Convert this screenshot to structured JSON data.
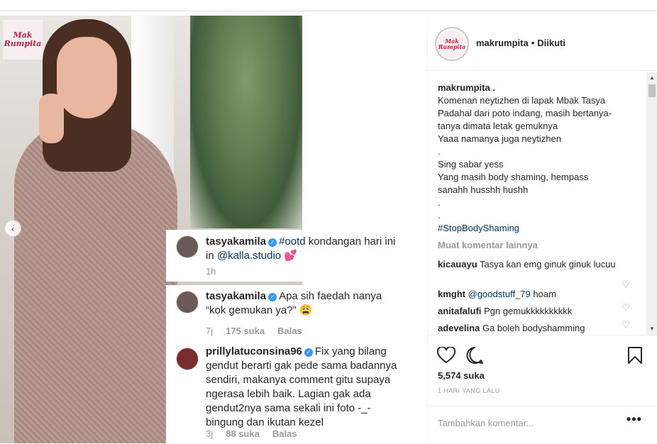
{
  "post_media": {
    "logo_text": "Mak Rumpita",
    "comments": [
      {
        "username": "tasyakamila",
        "hashtag": "#ootd",
        "text_1": "kondangan hari ini",
        "text_2_prefix": "in",
        "mention": "@kalla.studio",
        "emoji": "💕",
        "time": "1h"
      },
      {
        "username": "tasyakamila",
        "text_1": "Apa sih faedah nanya",
        "text_2": "“kok gemukan ya?”",
        "emoji": "😩",
        "time": "7j",
        "likes": "175 suka",
        "reply": "Balas"
      },
      {
        "username": "prillylatuconsina96",
        "text_1": "Fix yang bilang",
        "lines": [
          "gendut berarti gak pede sama badannya",
          "sendiri, makanya comment gitu supaya",
          "ngerasa lebih baik. Lagian gak ada",
          "gendut2nya sama sekali ini foto -_-",
          "bingung dan ikutan kezel"
        ],
        "time": "3j",
        "likes": "88 suka",
        "reply": "Balas"
      }
    ]
  },
  "header": {
    "avatar_text": "Mak Rumpita",
    "username": "makrumpita",
    "separator": "•",
    "follow_status": "Diikuti"
  },
  "caption": {
    "username": "makrumpita",
    "suffix": " .",
    "lines": [
      "Komenan neytizhen di lapak Mbak Tasya",
      "Padahal dari poto indang, masih bertanya-",
      "tanya dimata letak gemuknya",
      "Yaaa namanya juga neytizhen",
      ".",
      "Sing sabar yess",
      "Yang masih body shaming, hempass",
      "sanahh husshh hushh",
      ".",
      "."
    ],
    "hashtag": "#StopBodyShaming"
  },
  "more_comments": "Muat komentar lainnya",
  "comments": [
    {
      "username": "kicauayu",
      "text": "Tasya kan emg ginuk ginuk lucuu"
    },
    {
      "username": "kmght",
      "mention": "@goodstuff_79",
      "text": " hoam"
    },
    {
      "username": "anitafalufi",
      "text": "Pgn gemukkkkkkkkkk"
    },
    {
      "username": "adevelina",
      "text": "Ga boleh bodyshamming"
    }
  ],
  "actions": {
    "likes": "5,574 suka",
    "time": "1 HARI YANG LALU"
  },
  "add_comment": {
    "placeholder": "Tambahkan komentar...",
    "more": "•••"
  },
  "icons": {
    "like": "heart-icon",
    "comment": "comment-icon",
    "save": "bookmark-icon",
    "prev": "chevron-left-icon"
  }
}
